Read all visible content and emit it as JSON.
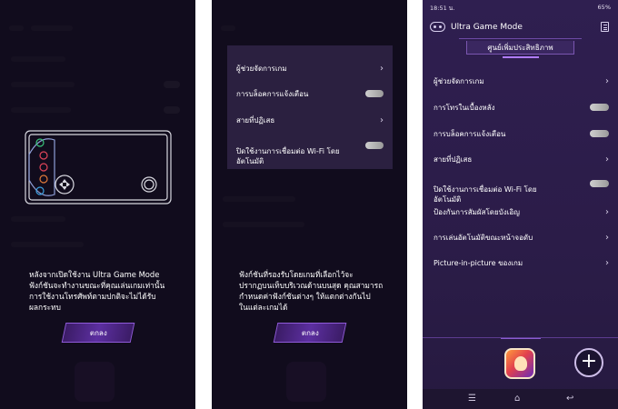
{
  "panel1": {
    "message": "หลังจากเปิดใช้งาน Ultra Game Mode\nฟังก์ชันจะทำงานขณะที่คุณเล่นเกมเท่านั้น\nการใช้งานโทรศัพท์ตามปกติจะไม่ได้รับ\nผลกระทบ",
    "ok_label": "ตกลง"
  },
  "panel2": {
    "popup_items": [
      {
        "label": "ผู้ช่วยจัดการเกม",
        "control": "chevron"
      },
      {
        "label": "การบล็อคการแจ้งเตือน",
        "control": "toggle"
      },
      {
        "label": "สายที่ปฏิเสธ",
        "control": "chevron"
      },
      {
        "label": "ปิดใช้งานการเชื่อมต่อ Wi-Fi โดย\nอัตโนมัติ",
        "control": "toggle"
      }
    ],
    "message": "ฟังก์ชันที่รองรับโดยเกมที่เลือกไว้จะ\nปรากฏบนเท็บบริเวณด้านบนสุด คุณสามารถ\nกำหนดค่าฟังก์ชันต่างๆ ให้แตกต่างกันไป\nในแต่ละเกมได้",
    "ok_label": "ตกลง"
  },
  "panel3": {
    "status_time": "18:51 น.",
    "status_battery": "65%",
    "title": "Ultra Game Mode",
    "tab_label": "ศูนย์เพิ่มประสิทธิภาพ",
    "items": [
      {
        "label": "ผู้ช่วยจัดการเกม",
        "control": "chevron"
      },
      {
        "label": "การโทรในเบื้องหลัง",
        "control": "toggle"
      },
      {
        "label": "การบล็อคการแจ้งเตือน",
        "control": "toggle"
      },
      {
        "label": "สายที่ปฏิเสธ",
        "control": "chevron"
      },
      {
        "label": "ปิดใช้งานการเชื่อมต่อ Wi-Fi โดย\nอัตโนมัติ",
        "control": "toggle"
      },
      {
        "label": "ป้องกันการสัมผัสโดยบังเอิญ",
        "control": "chevron"
      },
      {
        "label": "การเล่นอัตโนมัติขณะหน้าจอดับ",
        "control": "chevron"
      },
      {
        "label": "Picture-in-picture ของเกม",
        "control": "chevron"
      }
    ],
    "chevron_glyph": "›",
    "add_glyph": "+",
    "nav_icons": [
      "menu-icon",
      "home-icon",
      "back-icon"
    ]
  },
  "colors": {
    "accent": "#8f5ad9",
    "background": "#2b1c48",
    "toggle_off": "#b0b0b0"
  }
}
